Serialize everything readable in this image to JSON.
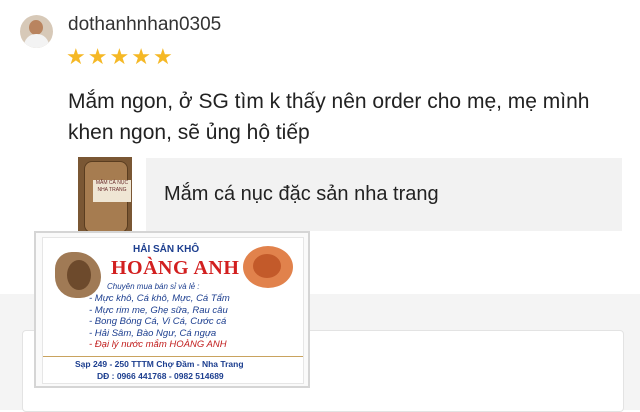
{
  "review": {
    "username": "dothanhnhan0305",
    "rating": 5,
    "star_glyph": "★",
    "text": "Mắm ngon, ở SG tìm k thấy nên order cho mẹ, mẹ mình khen ngon, sẽ ủng hộ tiếp"
  },
  "product": {
    "name": "Mắm cá nục đặc sản nha trang",
    "thumb_label": "MẮM CÁ NỤC NHA TRANG"
  },
  "photo_card": {
    "top": "HẢI SẢN KHÔ",
    "brand": "HOÀNG ANH",
    "subtitle": "Chuyên mua bán sỉ và lẻ :",
    "lines": [
      "- Mực khô, Cá khô, Mực, Cá Tẩm",
      "- Mực rim me, Ghẹ sữa, Rau câu",
      "- Bong Bóng Cá, Vi Cá, Cước cá",
      "- Hải Sâm, Bào Ngư, Cá ngựa",
      "- Đại lý nước mắm HOÀNG ANH"
    ],
    "address": "Sạp 249 - 250 TTTM Chợ Đầm - Nha Trang",
    "phone": "DĐ : 0966 441768 - 0982 514689"
  },
  "colors": {
    "star": "#f5b825",
    "brand_red": "#d21f1f",
    "brand_blue": "#1c3e8f"
  }
}
